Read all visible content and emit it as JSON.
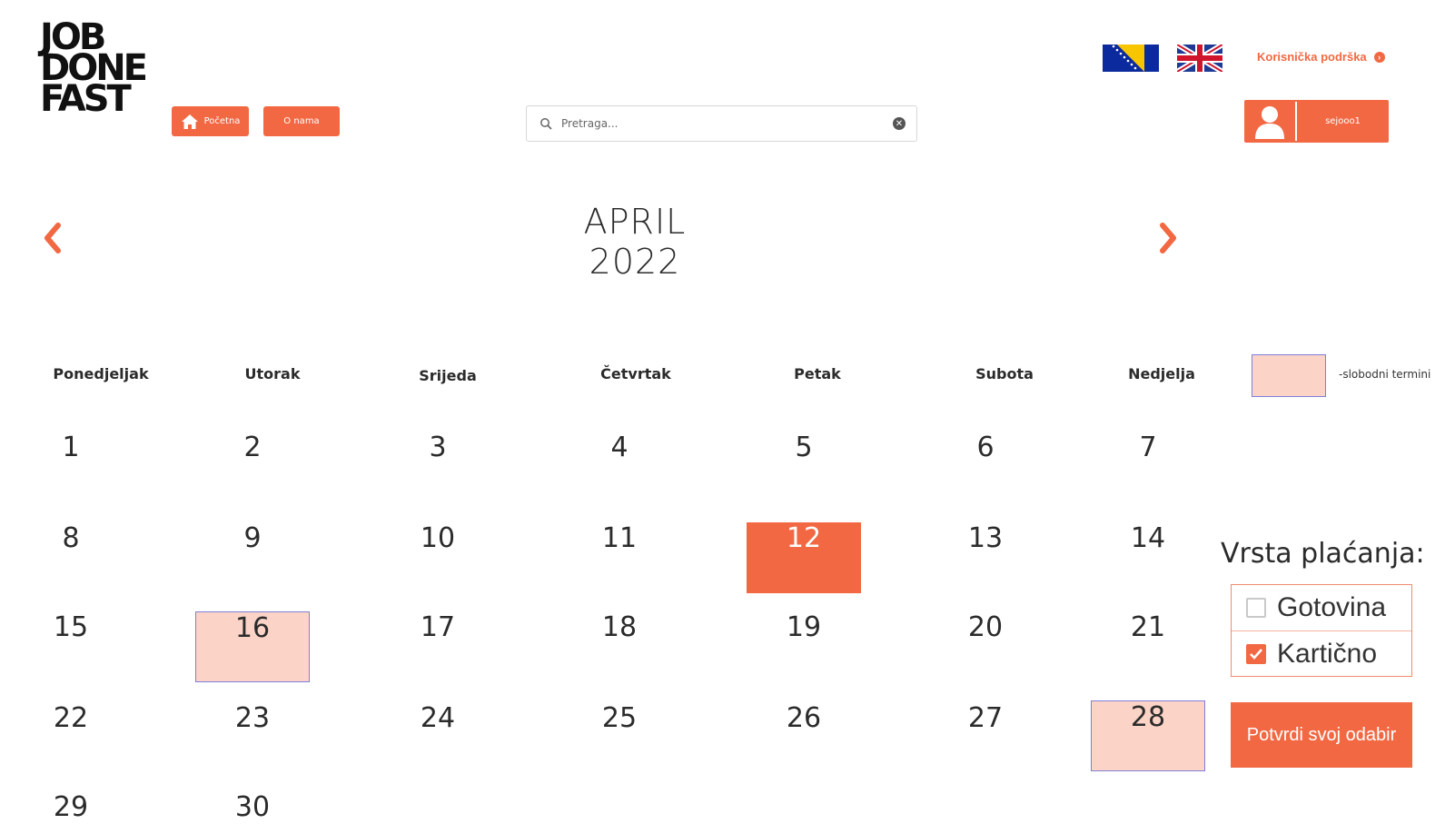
{
  "logo": {
    "line1": "JOB",
    "line2": "DONE",
    "line3": "FAST"
  },
  "nav": {
    "home_label": "Početna",
    "about_label": "O nama"
  },
  "search": {
    "placeholder": "Pretraga..."
  },
  "support": {
    "label": "Korisnička podrška"
  },
  "user": {
    "username": "sejooo1"
  },
  "calendar": {
    "month_title": "APRIL 2022",
    "weekdays": [
      "Ponedjeljak",
      "Utorak",
      "Srijeda",
      "Četvrtak",
      "Petak",
      "Subota",
      "Nedjelja"
    ],
    "days": [
      "1",
      "2",
      "3",
      "4",
      "5",
      "6",
      "7",
      "8",
      "9",
      "10",
      "11",
      "12",
      "13",
      "14",
      "15",
      "16",
      "17",
      "18",
      "19",
      "20",
      "21",
      "22",
      "23",
      "24",
      "25",
      "26",
      "27",
      "28",
      "29",
      "30"
    ],
    "free_days": [
      "16",
      "28"
    ],
    "selected_day": "12"
  },
  "legend": {
    "label": "-slobodni termini"
  },
  "payment": {
    "title": "Vrsta plaćanja:",
    "options": [
      {
        "label": "Gotovina",
        "checked": false
      },
      {
        "label": "Kartično",
        "checked": true
      }
    ],
    "confirm_label": "Potvrdi svoj odabir"
  },
  "colors": {
    "accent": "#f26843",
    "free_slot": "#fbd3c7",
    "free_slot_border": "#7f7fd8"
  }
}
